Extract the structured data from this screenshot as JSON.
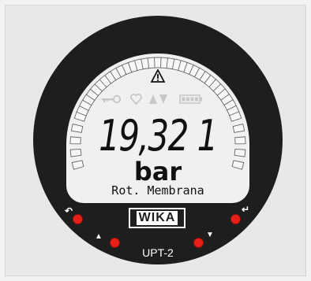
{
  "display": {
    "value": "19,32 1",
    "unit": "bar",
    "info_line": "Rot. Membrana"
  },
  "indicators": [
    "warning-icon",
    "key-icon",
    "heart-icon",
    "trend-arrows-icon",
    "battery-icon"
  ],
  "buttons": [
    {
      "name": "back-button",
      "symbol": "↶"
    },
    {
      "name": "enter-button",
      "symbol": "↵"
    },
    {
      "name": "up-button",
      "symbol": "▲"
    },
    {
      "name": "down-button",
      "symbol": "▼"
    }
  ],
  "brand": {
    "logo": "WIKA",
    "model": "UPT-2"
  },
  "colors": {
    "bezel": "#1e1e1e",
    "lcd": "#f0f0f0",
    "button": "#e8201a"
  }
}
